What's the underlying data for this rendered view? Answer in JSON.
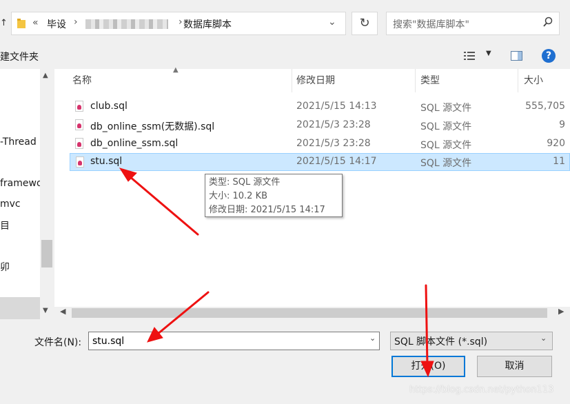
{
  "address": {
    "prefix": "«",
    "crumbs": [
      "毕设",
      "数据库脚本"
    ],
    "arrow": "›",
    "dropdown": "⌄",
    "refresh": "↻"
  },
  "search": {
    "placeholder": "搜索\"数据库脚本\""
  },
  "toolbar": {
    "new_folder": "建文件夹",
    "help": "?"
  },
  "nav": {
    "items": [
      {
        "label": "-Thread"
      },
      {
        "label": "framewo"
      },
      {
        "label": "mvc"
      },
      {
        "label": "目"
      },
      {
        "label": "卯"
      }
    ]
  },
  "columns": {
    "name": "名称",
    "modified": "修改日期",
    "type": "类型",
    "size": "大小"
  },
  "files": [
    {
      "name": "club.sql",
      "modified": "2021/5/15 14:13",
      "type": "SQL 源文件",
      "size": "555,705"
    },
    {
      "name": "db_online_ssm(无数据).sql",
      "modified": "2021/5/3 23:28",
      "type": "SQL 源文件",
      "size": "9"
    },
    {
      "name": "db_online_ssm.sql",
      "modified": "2021/5/3 23:28",
      "type": "SQL 源文件",
      "size": "920"
    },
    {
      "name": "stu.sql",
      "modified": "2021/5/15 14:17",
      "type": "SQL 源文件",
      "size": "11"
    }
  ],
  "tooltip": {
    "type": "类型: SQL 源文件",
    "size": "大小: 10.2 KB",
    "modified": "修改日期: 2021/5/15 14:17"
  },
  "form": {
    "filename_label": "文件名(N):",
    "filename_value": "stu.sql",
    "filetype": "SQL 脚本文件 (*.sql)",
    "open": "打开(O)",
    "cancel": "取消"
  },
  "watermark": "https://blog.csdn.net/python113",
  "colors": {
    "accent": "#0078d7",
    "selection": "#cce8ff",
    "arrow": "#ee1111"
  }
}
